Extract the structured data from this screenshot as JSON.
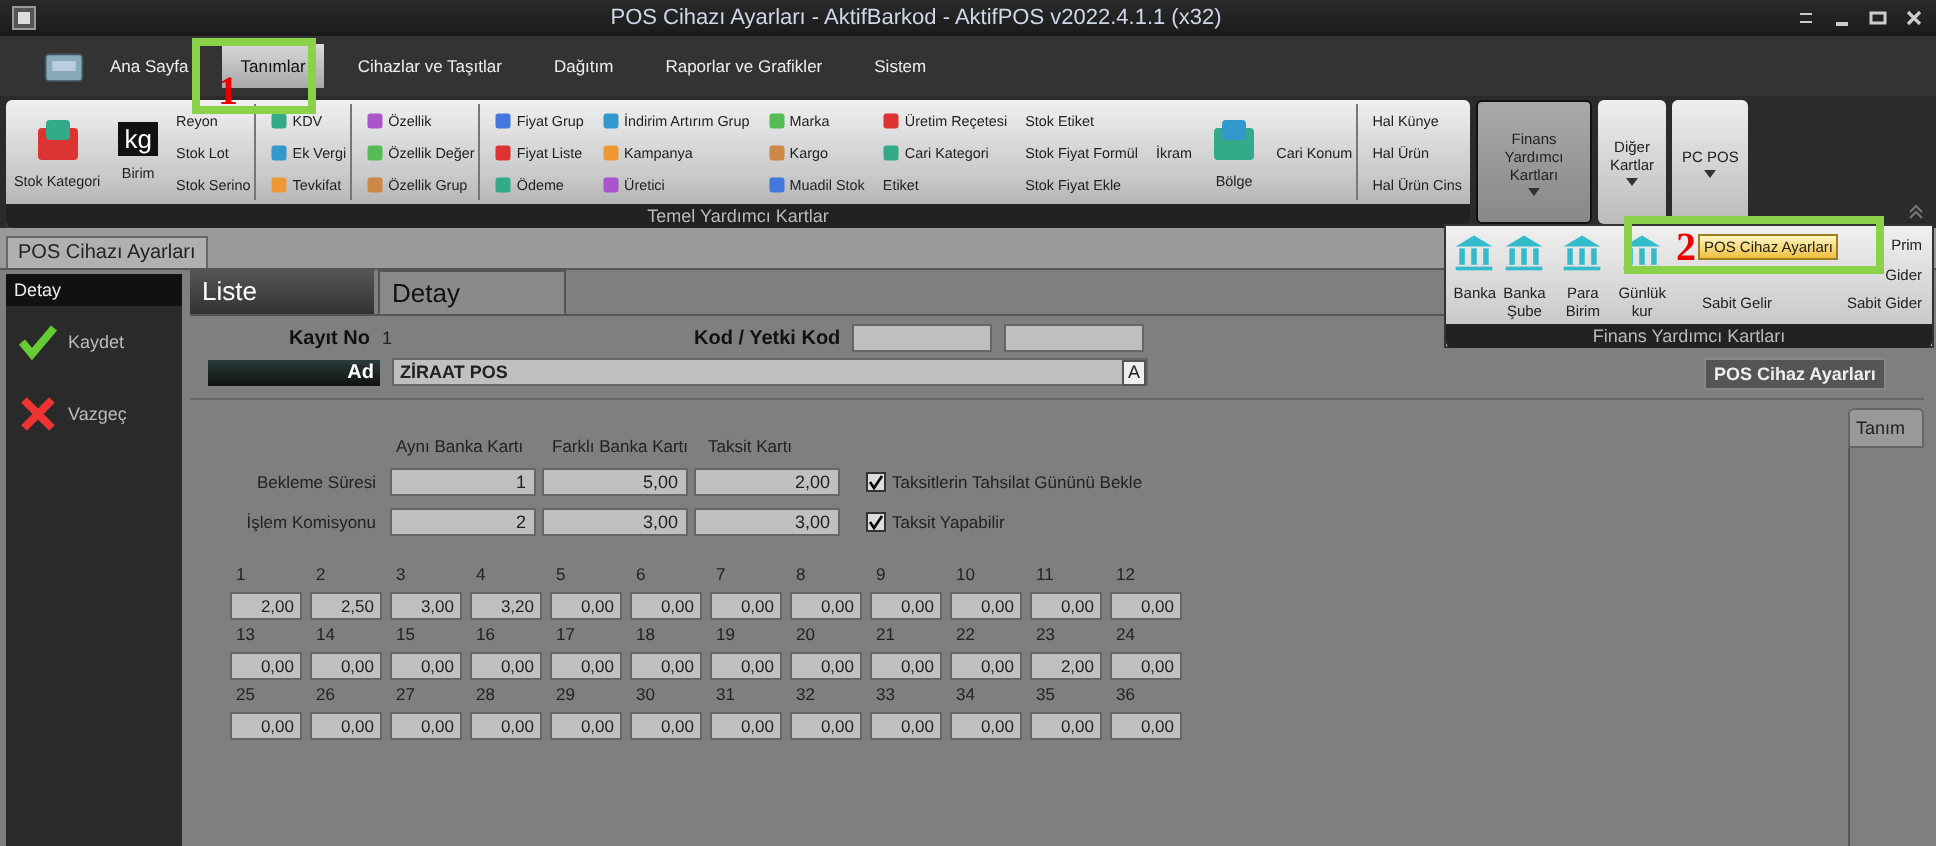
{
  "window": {
    "title": "POS Cihazı Ayarları - AktifBarkod - AktifPOS v2022.4.1.1 (x32)"
  },
  "ribbon_tabs": [
    {
      "label": "Ana Sayfa",
      "selected": false
    },
    {
      "label": "Tanımlar",
      "selected": true
    },
    {
      "label": "Cihazlar ve Taşıtlar",
      "selected": false
    },
    {
      "label": "Dağıtım",
      "selected": false
    },
    {
      "label": "Raporlar ve Grafikler",
      "selected": false
    },
    {
      "label": "Sistem",
      "selected": false
    }
  ],
  "ribbon_group": {
    "label": "Temel Yardımcı Kartlar",
    "columns": [
      {
        "kind": "large",
        "sep": false,
        "items": [
          {
            "label": "Stok Kategori",
            "icon": true
          }
        ]
      },
      {
        "kind": "large",
        "sep": false,
        "items": [
          {
            "label": "Birim",
            "icon": true,
            "badge": "kg"
          }
        ]
      },
      {
        "kind": "stack",
        "sep": true,
        "items": [
          {
            "label": "Reyon",
            "icon": false
          },
          {
            "label": "Stok Lot",
            "icon": false
          },
          {
            "label": "Stok Serino",
            "icon": false
          }
        ]
      },
      {
        "kind": "stack",
        "sep": true,
        "items": [
          {
            "label": "KDV",
            "icon": true
          },
          {
            "label": "Ek Vergi",
            "icon": true
          },
          {
            "label": "Tevkifat",
            "icon": true
          }
        ]
      },
      {
        "kind": "stack",
        "sep": true,
        "items": [
          {
            "label": "Özellik",
            "icon": true
          },
          {
            "label": "Özellik Değer",
            "icon": true
          },
          {
            "label": "Özellik Grup",
            "icon": true
          }
        ]
      },
      {
        "kind": "stack",
        "sep": false,
        "items": [
          {
            "label": "Fiyat Grup",
            "icon": true
          },
          {
            "label": "Fiyat Liste",
            "icon": true
          },
          {
            "label": "Ödeme",
            "icon": true
          }
        ]
      },
      {
        "kind": "stack",
        "sep": false,
        "items": [
          {
            "label": "İndirim Artırım Grup",
            "icon": true
          },
          {
            "label": "Kampanya",
            "icon": true
          },
          {
            "label": "Üretici",
            "icon": true
          }
        ]
      },
      {
        "kind": "stack",
        "sep": false,
        "items": [
          {
            "label": "Marka",
            "icon": true
          },
          {
            "label": "Kargo",
            "icon": true
          },
          {
            "label": "Muadil Stok",
            "icon": true
          }
        ]
      },
      {
        "kind": "stack",
        "sep": false,
        "items": [
          {
            "label": "Üretim Reçetesi",
            "icon": true
          },
          {
            "label": "Cari Kategori",
            "icon": true
          },
          {
            "label": "Etiket",
            "icon": false
          }
        ]
      },
      {
        "kind": "stack",
        "sep": false,
        "items": [
          {
            "label": "Stok Etiket",
            "icon": false
          },
          {
            "label": "Stok Fiyat Formül",
            "icon": false
          },
          {
            "label": "Stok Fiyat Ekle",
            "icon": false
          }
        ]
      },
      {
        "kind": "stack",
        "sep": false,
        "items": [
          {
            "label": "İkram",
            "icon": false
          }
        ]
      },
      {
        "kind": "large",
        "sep": false,
        "items": [
          {
            "label": "Bölge",
            "icon": true
          }
        ]
      },
      {
        "kind": "stack",
        "sep": true,
        "items": [
          {
            "label": "Cari Konum",
            "icon": false
          }
        ]
      },
      {
        "kind": "stack",
        "sep": false,
        "items": [
          {
            "label": "Hal Künye",
            "icon": false
          },
          {
            "label": "Hal Ürün",
            "icon": false
          },
          {
            "label": "Hal Ürün Cins",
            "icon": false
          }
        ]
      }
    ]
  },
  "ribbon_buttons": [
    {
      "label": "Finans Yardımcı Kartları",
      "pressed": true
    },
    {
      "label": "Diğer Kartlar",
      "pressed": false
    },
    {
      "label": "PC POS",
      "pressed": false
    }
  ],
  "finance_menu": {
    "label": "Finans Yardımcı Kartları",
    "large": [
      {
        "label": "Banka"
      },
      {
        "label": "Banka Şube"
      },
      {
        "label": "Para Birim"
      },
      {
        "label": "Günlük kur"
      }
    ],
    "middle": [
      {
        "label": "POS Cihaz Ayarları",
        "selected": true
      },
      {
        "label": "Sabit Gelir",
        "selected": false
      }
    ],
    "right": [
      {
        "label": "Prim"
      },
      {
        "label": "Gider"
      },
      {
        "label": "Sabit Gider"
      }
    ]
  },
  "tooltip": "POS Cihaz Ayarları",
  "document_tab": "POS Cihazı Ayarları",
  "sidebar": {
    "header": "Detay",
    "actions": [
      {
        "label": "Kaydet",
        "kind": "save"
      },
      {
        "label": "Vazgeç",
        "kind": "cancel"
      }
    ]
  },
  "detail_tabs": [
    {
      "label": "Liste",
      "selected": false
    },
    {
      "label": "Detay",
      "selected": true
    }
  ],
  "form": {
    "record_no_label": "Kayıt No",
    "record_no": "1",
    "code_label": "Kod / Yetki Kod",
    "name_label": "Ad",
    "name_value": "ZİRAAT POS",
    "name_button": "A"
  },
  "rates": {
    "columns": [
      "Aynı Banka Kartı",
      "Farklı Banka Kartı",
      "Taksit Kartı"
    ],
    "rows": [
      {
        "label": "Bekleme Süresi",
        "values": [
          "1",
          "5,00",
          "2,00"
        ]
      },
      {
        "label": "İşlem Komisyonu",
        "values": [
          "2",
          "3,00",
          "3,00"
        ]
      }
    ]
  },
  "options": [
    {
      "label": "Taksitlerin Tahsilat Gününü Bekle",
      "checked": true
    },
    {
      "label": "Taksit Yapabilir",
      "checked": true
    }
  ],
  "installments": [
    {
      "number": "1",
      "value": "2,00"
    },
    {
      "number": "2",
      "value": "2,50"
    },
    {
      "number": "3",
      "value": "3,00"
    },
    {
      "number": "4",
      "value": "3,20"
    },
    {
      "number": "5",
      "value": "0,00"
    },
    {
      "number": "6",
      "value": "0,00"
    },
    {
      "number": "7",
      "value": "0,00"
    },
    {
      "number": "8",
      "value": "0,00"
    },
    {
      "number": "9",
      "value": "0,00"
    },
    {
      "number": "10",
      "value": "0,00"
    },
    {
      "number": "11",
      "value": "0,00"
    },
    {
      "number": "12",
      "value": "0,00"
    },
    {
      "number": "13",
      "value": "0,00"
    },
    {
      "number": "14",
      "value": "0,00"
    },
    {
      "number": "15",
      "value": "0,00"
    },
    {
      "number": "16",
      "value": "0,00"
    },
    {
      "number": "17",
      "value": "0,00"
    },
    {
      "number": "18",
      "value": "0,00"
    },
    {
      "number": "19",
      "value": "0,00"
    },
    {
      "number": "20",
      "value": "0,00"
    },
    {
      "number": "21",
      "value": "0,00"
    },
    {
      "number": "22",
      "value": "0,00"
    },
    {
      "number": "23",
      "value": "2,00"
    },
    {
      "number": "24",
      "value": "0,00"
    },
    {
      "number": "25",
      "value": "0,00"
    },
    {
      "number": "26",
      "value": "0,00"
    },
    {
      "number": "27",
      "value": "0,00"
    },
    {
      "number": "28",
      "value": "0,00"
    },
    {
      "number": "29",
      "value": "0,00"
    },
    {
      "number": "30",
      "value": "0,00"
    },
    {
      "number": "31",
      "value": "0,00"
    },
    {
      "number": "32",
      "value": "0,00"
    },
    {
      "number": "33",
      "value": "0,00"
    },
    {
      "number": "34",
      "value": "0,00"
    },
    {
      "number": "35",
      "value": "0,00"
    },
    {
      "number": "36",
      "value": "0,00"
    }
  ],
  "side_tab": "Tanım",
  "annotations": [
    {
      "number": "1"
    },
    {
      "number": "2"
    }
  ]
}
